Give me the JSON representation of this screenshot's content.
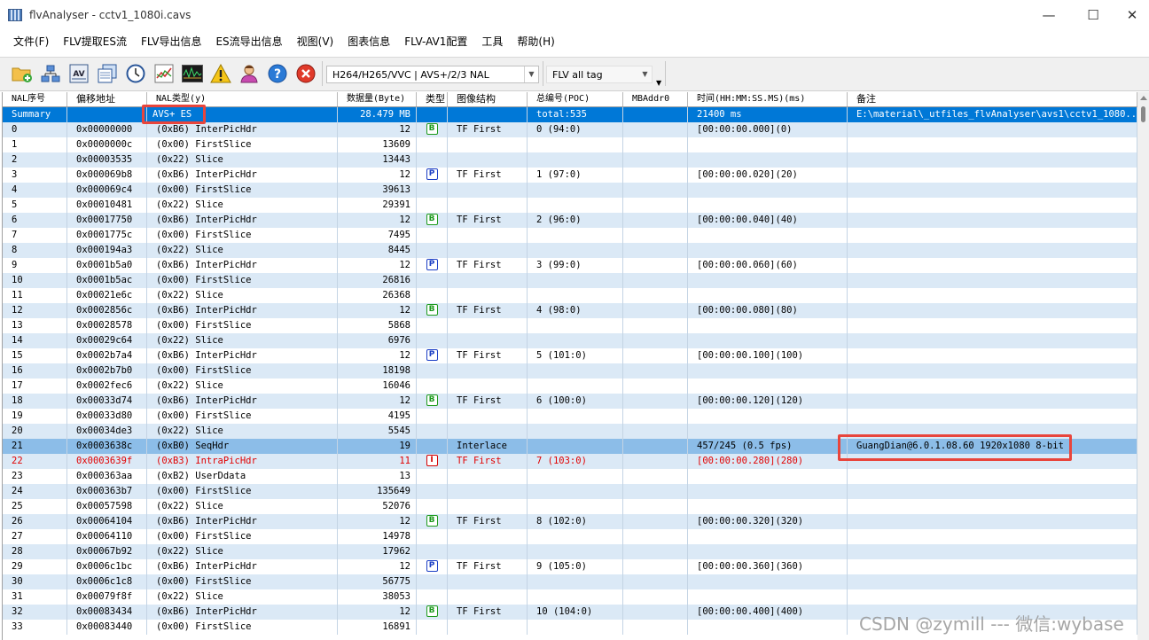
{
  "window": {
    "title": "flvAnalyser - cctv1_1080i.cavs",
    "minimize_glyph": "—",
    "maximize_glyph": "☐",
    "close_glyph": "✕"
  },
  "menu": [
    "文件(F)",
    "FLV提取ES流",
    "FLV导出信息",
    "ES流导出信息",
    "视图(V)",
    "图表信息",
    "FLV-AV1配置",
    "工具",
    "帮助(H)"
  ],
  "toolbar": {
    "icons": [
      "open-folder-icon",
      "network-icon",
      "av-icon",
      "copy-windows-icon",
      "clock-icon",
      "chart-icon",
      "waveform-icon",
      "warning-icon",
      "user-icon",
      "help-icon",
      "close-circle-icon"
    ],
    "combo1": "H264/H265/VVC | AVS+/2/3 NAL",
    "combo2": "FLV all tag"
  },
  "table": {
    "columns": [
      "NAL序号",
      "偏移地址",
      "NAL类型(y)",
      "数据量(Byte)",
      "类型",
      "图像结构",
      "总编号(POC)",
      "MBAddr0",
      "时间(HH:MM:SS.MS)(ms)",
      "备注"
    ],
    "summary": {
      "id": "Summary",
      "offset": "",
      "nal_type": "AVS+ ES",
      "size": "28.479 MB",
      "frame": "",
      "structure": "",
      "poc": "total:535",
      "mbaddr": "",
      "time": "21400 ms",
      "note": "E:\\material\\_utfiles_flvAnalyser\\avs1\\cctv1_1080..."
    },
    "rows": [
      {
        "id": "0",
        "offset": "0x00000000",
        "nal_type": "(0xB6) InterPicHdr",
        "size": "12",
        "frame": "B",
        "structure": "TF First",
        "poc": "0 (94:0)",
        "mbaddr": "",
        "time": "[00:00:00.000](0)",
        "note": ""
      },
      {
        "id": "1",
        "offset": "0x0000000c",
        "nal_type": "(0x00) FirstSlice",
        "size": "13609",
        "frame": "",
        "structure": "",
        "poc": "",
        "mbaddr": "",
        "time": "",
        "note": ""
      },
      {
        "id": "2",
        "offset": "0x00003535",
        "nal_type": "(0x22) Slice",
        "size": "13443",
        "frame": "",
        "structure": "",
        "poc": "",
        "mbaddr": "",
        "time": "",
        "note": ""
      },
      {
        "id": "3",
        "offset": "0x000069b8",
        "nal_type": "(0xB6) InterPicHdr",
        "size": "12",
        "frame": "P",
        "structure": "TF First",
        "poc": "1 (97:0)",
        "mbaddr": "",
        "time": "[00:00:00.020](20)",
        "note": ""
      },
      {
        "id": "4",
        "offset": "0x000069c4",
        "nal_type": "(0x00) FirstSlice",
        "size": "39613",
        "frame": "",
        "structure": "",
        "poc": "",
        "mbaddr": "",
        "time": "",
        "note": ""
      },
      {
        "id": "5",
        "offset": "0x00010481",
        "nal_type": "(0x22) Slice",
        "size": "29391",
        "frame": "",
        "structure": "",
        "poc": "",
        "mbaddr": "",
        "time": "",
        "note": ""
      },
      {
        "id": "6",
        "offset": "0x00017750",
        "nal_type": "(0xB6) InterPicHdr",
        "size": "12",
        "frame": "B",
        "structure": "TF First",
        "poc": "2 (96:0)",
        "mbaddr": "",
        "time": "[00:00:00.040](40)",
        "note": ""
      },
      {
        "id": "7",
        "offset": "0x0001775c",
        "nal_type": "(0x00) FirstSlice",
        "size": "7495",
        "frame": "",
        "structure": "",
        "poc": "",
        "mbaddr": "",
        "time": "",
        "note": ""
      },
      {
        "id": "8",
        "offset": "0x000194a3",
        "nal_type": "(0x22) Slice",
        "size": "8445",
        "frame": "",
        "structure": "",
        "poc": "",
        "mbaddr": "",
        "time": "",
        "note": ""
      },
      {
        "id": "9",
        "offset": "0x0001b5a0",
        "nal_type": "(0xB6) InterPicHdr",
        "size": "12",
        "frame": "P",
        "structure": "TF First",
        "poc": "3 (99:0)",
        "mbaddr": "",
        "time": "[00:00:00.060](60)",
        "note": ""
      },
      {
        "id": "10",
        "offset": "0x0001b5ac",
        "nal_type": "(0x00) FirstSlice",
        "size": "26816",
        "frame": "",
        "structure": "",
        "poc": "",
        "mbaddr": "",
        "time": "",
        "note": ""
      },
      {
        "id": "11",
        "offset": "0x00021e6c",
        "nal_type": "(0x22) Slice",
        "size": "26368",
        "frame": "",
        "structure": "",
        "poc": "",
        "mbaddr": "",
        "time": "",
        "note": ""
      },
      {
        "id": "12",
        "offset": "0x0002856c",
        "nal_type": "(0xB6) InterPicHdr",
        "size": "12",
        "frame": "B",
        "structure": "TF First",
        "poc": "4 (98:0)",
        "mbaddr": "",
        "time": "[00:00:00.080](80)",
        "note": ""
      },
      {
        "id": "13",
        "offset": "0x00028578",
        "nal_type": "(0x00) FirstSlice",
        "size": "5868",
        "frame": "",
        "structure": "",
        "poc": "",
        "mbaddr": "",
        "time": "",
        "note": ""
      },
      {
        "id": "14",
        "offset": "0x00029c64",
        "nal_type": "(0x22) Slice",
        "size": "6976",
        "frame": "",
        "structure": "",
        "poc": "",
        "mbaddr": "",
        "time": "",
        "note": ""
      },
      {
        "id": "15",
        "offset": "0x0002b7a4",
        "nal_type": "(0xB6) InterPicHdr",
        "size": "12",
        "frame": "P",
        "structure": "TF First",
        "poc": "5 (101:0)",
        "mbaddr": "",
        "time": "[00:00:00.100](100)",
        "note": ""
      },
      {
        "id": "16",
        "offset": "0x0002b7b0",
        "nal_type": "(0x00) FirstSlice",
        "size": "18198",
        "frame": "",
        "structure": "",
        "poc": "",
        "mbaddr": "",
        "time": "",
        "note": ""
      },
      {
        "id": "17",
        "offset": "0x0002fec6",
        "nal_type": "(0x22) Slice",
        "size": "16046",
        "frame": "",
        "structure": "",
        "poc": "",
        "mbaddr": "",
        "time": "",
        "note": ""
      },
      {
        "id": "18",
        "offset": "0x00033d74",
        "nal_type": "(0xB6) InterPicHdr",
        "size": "12",
        "frame": "B",
        "structure": "TF First",
        "poc": "6 (100:0)",
        "mbaddr": "",
        "time": "[00:00:00.120](120)",
        "note": ""
      },
      {
        "id": "19",
        "offset": "0x00033d80",
        "nal_type": "(0x00) FirstSlice",
        "size": "4195",
        "frame": "",
        "structure": "",
        "poc": "",
        "mbaddr": "",
        "time": "",
        "note": ""
      },
      {
        "id": "20",
        "offset": "0x00034de3",
        "nal_type": "(0x22) Slice",
        "size": "5545",
        "frame": "",
        "structure": "",
        "poc": "",
        "mbaddr": "",
        "time": "",
        "note": ""
      },
      {
        "id": "21",
        "offset": "0x0003638c",
        "nal_type": "(0xB0) SeqHdr",
        "size": "19",
        "frame": "",
        "structure": "Interlace",
        "poc": "",
        "mbaddr": "",
        "time": "457/245 (0.5 fps)",
        "note": "GuangDian@6.0.1.08.60  1920x1080  8-bit",
        "style": "highlight"
      },
      {
        "id": "22",
        "offset": "0x0003639f",
        "nal_type": "(0xB3) IntraPicHdr",
        "size": "11",
        "frame": "I",
        "structure": "TF First",
        "poc": "7 (103:0)",
        "mbaddr": "",
        "time": "[00:00:00.280](280)",
        "note": "",
        "style": "red"
      },
      {
        "id": "23",
        "offset": "0x000363aa",
        "nal_type": "(0xB2) UserDdata",
        "size": "13",
        "frame": "",
        "structure": "",
        "poc": "",
        "mbaddr": "",
        "time": "",
        "note": ""
      },
      {
        "id": "24",
        "offset": "0x000363b7",
        "nal_type": "(0x00) FirstSlice",
        "size": "135649",
        "frame": "",
        "structure": "",
        "poc": "",
        "mbaddr": "",
        "time": "",
        "note": ""
      },
      {
        "id": "25",
        "offset": "0x00057598",
        "nal_type": "(0x22) Slice",
        "size": "52076",
        "frame": "",
        "structure": "",
        "poc": "",
        "mbaddr": "",
        "time": "",
        "note": ""
      },
      {
        "id": "26",
        "offset": "0x00064104",
        "nal_type": "(0xB6) InterPicHdr",
        "size": "12",
        "frame": "B",
        "structure": "TF First",
        "poc": "8 (102:0)",
        "mbaddr": "",
        "time": "[00:00:00.320](320)",
        "note": ""
      },
      {
        "id": "27",
        "offset": "0x00064110",
        "nal_type": "(0x00) FirstSlice",
        "size": "14978",
        "frame": "",
        "structure": "",
        "poc": "",
        "mbaddr": "",
        "time": "",
        "note": ""
      },
      {
        "id": "28",
        "offset": "0x00067b92",
        "nal_type": "(0x22) Slice",
        "size": "17962",
        "frame": "",
        "structure": "",
        "poc": "",
        "mbaddr": "",
        "time": "",
        "note": ""
      },
      {
        "id": "29",
        "offset": "0x0006c1bc",
        "nal_type": "(0xB6) InterPicHdr",
        "size": "12",
        "frame": "P",
        "structure": "TF First",
        "poc": "9 (105:0)",
        "mbaddr": "",
        "time": "[00:00:00.360](360)",
        "note": ""
      },
      {
        "id": "30",
        "offset": "0x0006c1c8",
        "nal_type": "(0x00) FirstSlice",
        "size": "56775",
        "frame": "",
        "structure": "",
        "poc": "",
        "mbaddr": "",
        "time": "",
        "note": ""
      },
      {
        "id": "31",
        "offset": "0x00079f8f",
        "nal_type": "(0x22) Slice",
        "size": "38053",
        "frame": "",
        "structure": "",
        "poc": "",
        "mbaddr": "",
        "time": "",
        "note": ""
      },
      {
        "id": "32",
        "offset": "0x00083434",
        "nal_type": "(0xB6) InterPicHdr",
        "size": "12",
        "frame": "B",
        "structure": "TF First",
        "poc": "10 (104:0)",
        "mbaddr": "",
        "time": "[00:00:00.400](400)",
        "note": ""
      },
      {
        "id": "33",
        "offset": "0x00083440",
        "nal_type": "(0x00) FirstSlice",
        "size": "16891",
        "frame": "",
        "structure": "",
        "poc": "",
        "mbaddr": "",
        "time": "",
        "note": ""
      }
    ]
  },
  "watermark": "CSDN @zymill --- 微信:wybase",
  "colors": {
    "selected_row": "#0078d7",
    "highlight_row": "#8cbde8",
    "alt_row": "#dbe9f6",
    "annotation_box": "#e8453c",
    "i_frame_red": "#e00000"
  }
}
